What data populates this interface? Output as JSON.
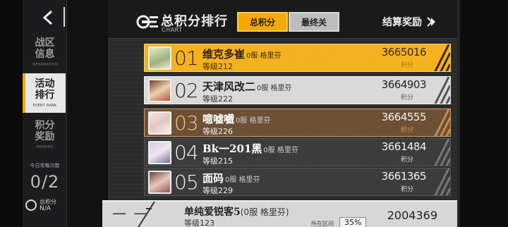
{
  "header": {
    "title_zh": "总积分排行",
    "title_en": "CHART",
    "tabs": [
      {
        "label": "总积分",
        "active": true
      },
      {
        "label": "最终关",
        "active": false
      }
    ],
    "settle_label": "结算奖励"
  },
  "sidebar": {
    "items": [
      {
        "zh": "战区信息",
        "en": "INFORMATION",
        "active": false
      },
      {
        "zh": "活动排行",
        "en": "EVENT RANK",
        "active": true
      },
      {
        "zh": "积分奖励",
        "en": "REWARD",
        "active": false
      }
    ],
    "attempts_label": "今日攻略次数",
    "attempts_value": "0/2",
    "score_label": "总积分",
    "score_value": "N/A"
  },
  "rows": [
    {
      "rank": "01",
      "name": "维克多崔",
      "server": "0服 格里芬",
      "level": "等级212",
      "score": "3665016",
      "score_label": "积分"
    },
    {
      "rank": "02",
      "name": "天津风改二",
      "server": "0服 格里芬",
      "level": "等级222",
      "score": "3664903",
      "score_label": "积分"
    },
    {
      "rank": "03",
      "name": "噫嘘嚱",
      "server": "0服 格里芬",
      "level": "等级226",
      "score": "3664555",
      "score_label": "积分"
    },
    {
      "rank": "04",
      "name": "Bk一201黑",
      "server": "0服 格里芬",
      "level": "等级215",
      "score": "3661484",
      "score_label": "积分"
    },
    {
      "rank": "05",
      "name": "面码",
      "server": "0服 格里芬",
      "level": "等级229",
      "score": "3661365",
      "score_label": "积分"
    }
  ],
  "me": {
    "rank": "— —",
    "name": "单纯爱锐客5",
    "server": "(0服 格里芬)",
    "level": "等级123",
    "score": "2004369",
    "interval_label": "所在区间",
    "interval_value": "35%"
  },
  "colors": {
    "accent": "#f5a800",
    "silver": "#d9d9d9",
    "bronze": "#6b4f33"
  }
}
